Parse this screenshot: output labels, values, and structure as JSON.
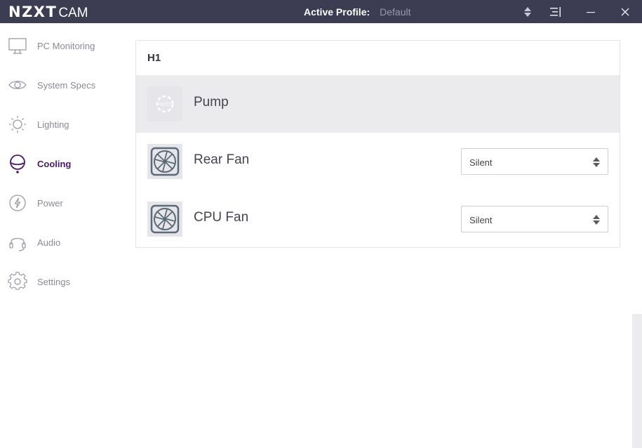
{
  "app": {
    "logo_primary": "NZXT",
    "logo_secondary": "CAM"
  },
  "header": {
    "profile_label": "Active Profile:",
    "profile_value": "Default"
  },
  "sidebar": {
    "items": [
      {
        "label": "PC Monitoring",
        "icon": "monitor-icon",
        "active": false
      },
      {
        "label": "System Specs",
        "icon": "eye-icon",
        "active": false
      },
      {
        "label": "Lighting",
        "icon": "sun-icon",
        "active": false
      },
      {
        "label": "Cooling",
        "icon": "cooling-icon",
        "active": true
      },
      {
        "label": "Power",
        "icon": "lightning-icon",
        "active": false
      },
      {
        "label": "Audio",
        "icon": "headphones-icon",
        "active": false
      },
      {
        "label": "Settings",
        "icon": "gear-icon",
        "active": false
      }
    ]
  },
  "main": {
    "device_title": "H1",
    "rows": [
      {
        "label": "Pump",
        "icon": "pump-icon",
        "selected": true
      },
      {
        "label": "Rear Fan",
        "icon": "fan-icon",
        "mode": "Silent"
      },
      {
        "label": "CPU Fan",
        "icon": "fan-icon",
        "mode": "Silent"
      }
    ]
  },
  "colors": {
    "titlebar": "#3c3c52",
    "accent": "#4a1a6e",
    "selected_row": "#ebebed"
  }
}
